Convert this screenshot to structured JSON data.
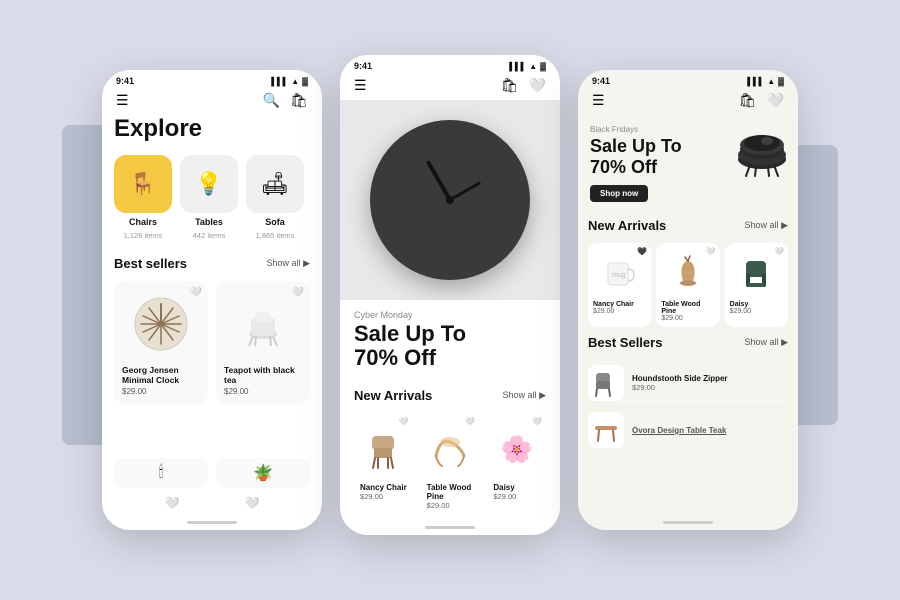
{
  "background": "#d8dce8",
  "phones": [
    {
      "id": "explore",
      "status_time": "9:41",
      "nav": {
        "left_icon": "☰",
        "right_icons": [
          "🔍",
          "🛍"
        ]
      },
      "title": "Explore",
      "categories": [
        {
          "icon": "🪑",
          "label": "Chairs",
          "count": "1,126 items",
          "active": true
        },
        {
          "icon": "💡",
          "label": "Tables",
          "count": "442 items",
          "active": false
        },
        {
          "icon": "🛋",
          "label": "Sofa",
          "count": "1,865 items",
          "active": false
        }
      ],
      "best_sellers": {
        "title": "Best sellers",
        "show_all": "Show all ▶",
        "products": [
          {
            "name": "Georg Jensen Minimal Clock",
            "price": "$29.00",
            "icon": "🌟"
          },
          {
            "name": "Teapot with black tea",
            "price": "$29.00",
            "icon": "🫖"
          }
        ]
      }
    },
    {
      "id": "middle",
      "status_time": "9:41",
      "nav": {
        "left_icon": "☰",
        "right_icons": [
          "🛍",
          "🤍"
        ]
      },
      "promo": {
        "label": "Cyber Monday",
        "title": "Sale Up To\n70% Off"
      },
      "new_arrivals": {
        "title": "New Arrivals",
        "show_all": "Show all ▶",
        "products": [
          {
            "name": "Nancy Chair",
            "price": "$29.00",
            "icon": "🪑"
          },
          {
            "name": "Table Wood Pine",
            "price": "$29.00",
            "icon": "🪵"
          },
          {
            "name": "Daisy",
            "price": "$29.00",
            "icon": "🌸"
          }
        ]
      }
    },
    {
      "id": "right",
      "status_time": "9:41",
      "nav": {
        "left_icon": "☰",
        "right_icons": [
          "🛍",
          "🤍"
        ]
      },
      "promo": {
        "label": "Black Fridays",
        "title": "Sale Up To\n70% Off",
        "button": "Shop now"
      },
      "new_arrivals": {
        "title": "New Arrivals",
        "show_all": "Show all ▶",
        "products": [
          {
            "name": "Nancy Chair",
            "price": "$29.00",
            "icon": "🪑"
          },
          {
            "name": "Table Wood Pine",
            "price": "$29.00",
            "icon": "🪵"
          },
          {
            "name": "Daisy",
            "price": "$29.00",
            "icon": "🌿"
          }
        ]
      },
      "best_sellers": {
        "title": "Best Sellers",
        "show_all": "Show all ▶",
        "products": [
          {
            "name": "Houndstooth Side Zipper",
            "price": "$29.00",
            "icon": "🪑"
          },
          {
            "name": "Ovora Design Table Teak",
            "price": "",
            "icon": "🪵"
          }
        ]
      }
    }
  ]
}
